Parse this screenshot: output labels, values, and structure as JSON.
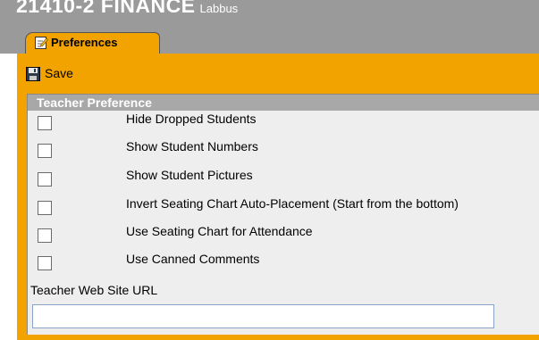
{
  "header": {
    "course_title": "21410-2 FINANCE",
    "teacher_name": "Labbus"
  },
  "tabs": [
    {
      "label": "Preferences",
      "icon": "edit-note-icon",
      "active": true
    }
  ],
  "toolbar": {
    "save_label": "Save",
    "save_icon": "floppy-disk-icon"
  },
  "panel": {
    "title": "Teacher Preference",
    "preferences": [
      {
        "label": "Hide Dropped Students",
        "checked": false
      },
      {
        "label": "Show Student Numbers",
        "checked": false
      },
      {
        "label": "Show Student Pictures",
        "checked": false
      },
      {
        "label": "Invert Seating Chart Auto-Placement (Start from the bottom)",
        "checked": false
      },
      {
        "label": "Use Seating Chart for Attendance",
        "checked": false
      },
      {
        "label": "Use Canned Comments",
        "checked": false
      }
    ],
    "url_label": "Teacher Web Site URL",
    "url_value": ""
  },
  "colors": {
    "accent": "#f2a300",
    "header_bg": "#9a9a9a",
    "panel_header_bg": "#a8a8a8",
    "panel_bg": "#eeeeee"
  }
}
